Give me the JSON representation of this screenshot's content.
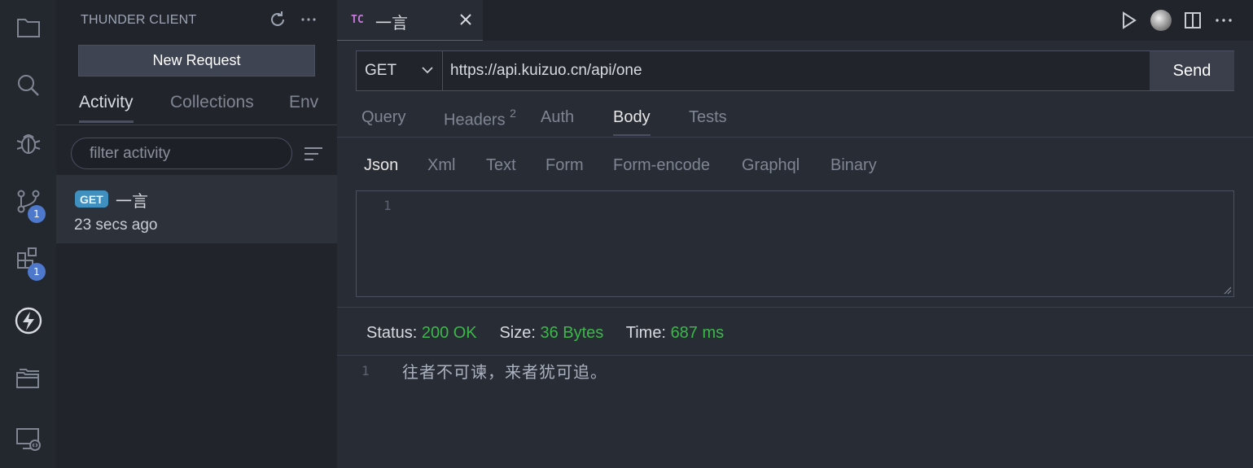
{
  "activity_bar": {
    "items": [
      {
        "name": "explorer",
        "icon": "files-icon"
      },
      {
        "name": "search",
        "icon": "search-icon"
      },
      {
        "name": "debug",
        "icon": "bug-icon"
      },
      {
        "name": "source-control",
        "icon": "source-control-icon",
        "badge": "1"
      },
      {
        "name": "extensions",
        "icon": "extensions-icon",
        "badge": "1"
      },
      {
        "name": "thunder-client",
        "icon": "lightning-icon"
      },
      {
        "name": "folders",
        "icon": "folders-icon"
      },
      {
        "name": "remote-explorer",
        "icon": "remote-explorer-icon"
      }
    ]
  },
  "sidebar": {
    "title": "THUNDER CLIENT",
    "new_request_label": "New Request",
    "tabs": [
      {
        "label": "Activity",
        "active": true
      },
      {
        "label": "Collections",
        "active": false
      },
      {
        "label": "Env",
        "active": false
      }
    ],
    "filter_placeholder": "filter activity",
    "requests": [
      {
        "method": "GET",
        "name": "一言",
        "time": "23 secs ago"
      }
    ]
  },
  "editor_tab": {
    "icon_text": "TC",
    "label": "一言"
  },
  "request": {
    "method": "GET",
    "url": "https://api.kuizuo.cn/api/one",
    "send_label": "Send",
    "tabs": [
      {
        "label": "Query",
        "active": false
      },
      {
        "label": "Headers",
        "count": "2",
        "active": false
      },
      {
        "label": "Auth",
        "active": false
      },
      {
        "label": "Body",
        "active": true
      },
      {
        "label": "Tests",
        "active": false
      }
    ],
    "body_tabs": [
      {
        "label": "Json",
        "active": true
      },
      {
        "label": "Xml",
        "active": false
      },
      {
        "label": "Text",
        "active": false
      },
      {
        "label": "Form",
        "active": false
      },
      {
        "label": "Form-encode",
        "active": false
      },
      {
        "label": "Graphql",
        "active": false
      },
      {
        "label": "Binary",
        "active": false
      }
    ],
    "body_line_number": "1"
  },
  "response": {
    "status_label": "Status:",
    "status_value": "200 OK",
    "size_label": "Size:",
    "size_value": "36 Bytes",
    "time_label": "Time:",
    "time_value": "687 ms",
    "line_number": "1",
    "body": "往者不可谏，来者犹可追。"
  },
  "colors": {
    "accent_badge": "#4d78cc",
    "method_get": "#3f8fbf",
    "success": "#3cb84a",
    "tc_icon": "#c678dd"
  }
}
